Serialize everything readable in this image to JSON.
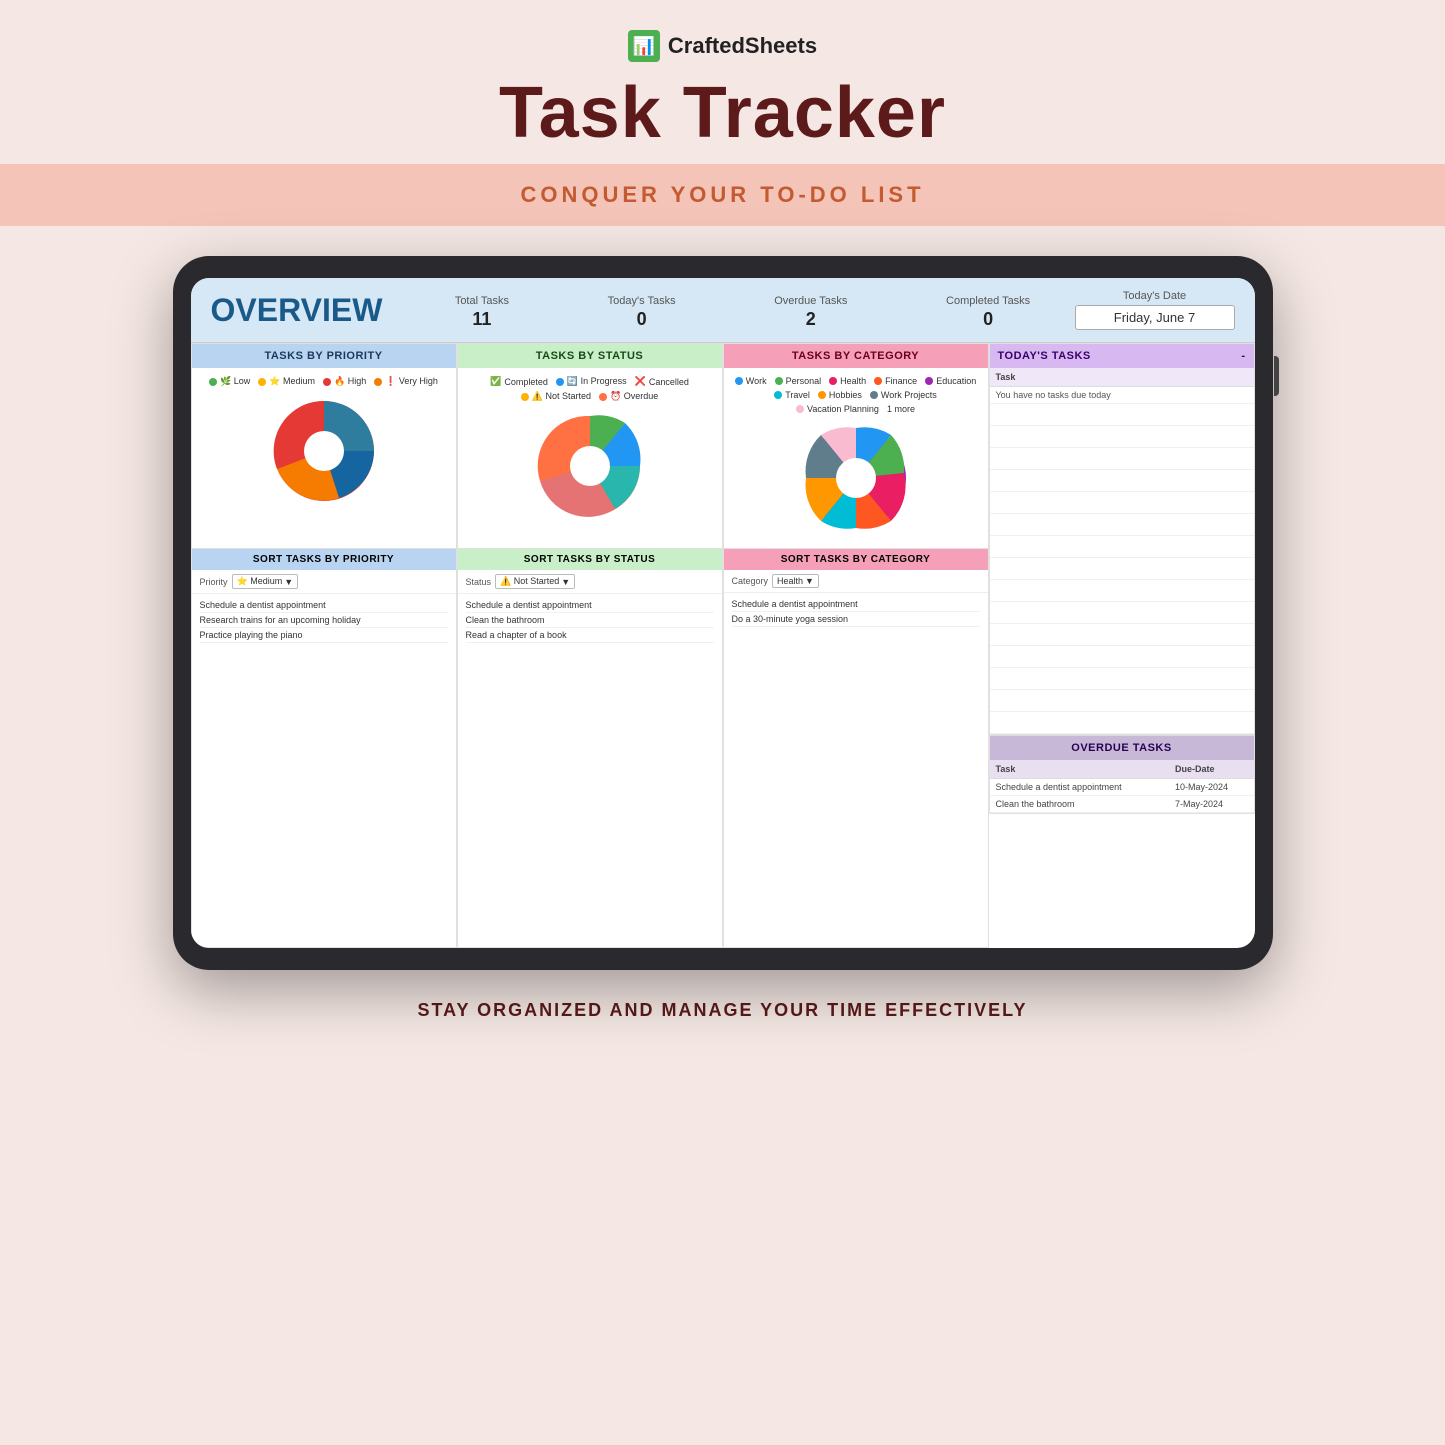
{
  "brand": {
    "name": "CraftedSheets",
    "icon": "📊"
  },
  "page_title": "Task Tracker",
  "subtitle": "CONQUER YOUR TO-DO LIST",
  "footer": "STAY ORGANIZED AND MANAGE YOUR TIME EFFECTIVELY",
  "overview": {
    "title": "OVERVIEW",
    "stats": {
      "total_tasks_label": "Total Tasks",
      "total_tasks_value": "11",
      "todays_tasks_label": "Today's Tasks",
      "todays_tasks_value": "0",
      "overdue_tasks_label": "Overdue Tasks",
      "overdue_tasks_value": "2",
      "completed_tasks_label": "Completed Tasks",
      "completed_tasks_value": "0"
    },
    "date": {
      "label": "Today's Date",
      "value": "Friday, June 7"
    }
  },
  "tasks_by_priority": {
    "header": "TASKS BY PRIORITY",
    "legend": [
      {
        "label": "Low",
        "color": "#4caf50",
        "icon": "🌿"
      },
      {
        "label": "Medium",
        "color": "#ffb300",
        "icon": "⭐"
      },
      {
        "label": "High",
        "color": "#e53935",
        "icon": "🔥"
      },
      {
        "label": "Very High",
        "color": "#f57c00",
        "icon": "❗"
      }
    ]
  },
  "tasks_by_status": {
    "header": "TASKS BY STATUS",
    "legend": [
      {
        "label": "Completed",
        "color": "#4caf50",
        "icon": "✅"
      },
      {
        "label": "In Progress",
        "color": "#2196f3",
        "icon": "🔄"
      },
      {
        "label": "Cancelled",
        "color": "#e53935",
        "icon": "❌"
      },
      {
        "label": "Not Started",
        "color": "#ffb300",
        "icon": "⚠️"
      },
      {
        "label": "Overdue",
        "color": "#ff7043",
        "icon": "⏰"
      }
    ]
  },
  "tasks_by_category": {
    "header": "TASKS BY CATEGORY",
    "legend": [
      {
        "label": "Work",
        "color": "#2196f3"
      },
      {
        "label": "Personal",
        "color": "#4caf50"
      },
      {
        "label": "Health",
        "color": "#e91e63"
      },
      {
        "label": "Finance",
        "color": "#ff5722"
      },
      {
        "label": "Education",
        "color": "#9c27b0"
      },
      {
        "label": "Travel",
        "color": "#00bcd4"
      },
      {
        "label": "Hobbies",
        "color": "#ff9800"
      },
      {
        "label": "Work Projects",
        "color": "#607d8b"
      },
      {
        "label": "Vacation Planning",
        "color": "#f8bbd0"
      },
      {
        "label": "1 more",
        "color": ""
      }
    ]
  },
  "todays_tasks": {
    "header": "TODAY'S TASKS",
    "table_header": "Task",
    "note": "You have no tasks due today",
    "items": []
  },
  "sort_priority": {
    "header": "SORT TASKS BY PRIORITY",
    "label": "Priority",
    "value": "⭐ Medium",
    "tasks": [
      "Schedule a dentist appointment",
      "Research trains for an upcoming holiday",
      "Practice playing the piano"
    ]
  },
  "sort_status": {
    "header": "SORT TASKS BY STATUS",
    "label": "Status",
    "value": "⚠️ Not Started",
    "tasks": [
      "Schedule a dentist appointment",
      "Clean the bathroom",
      "Read a chapter of a book"
    ]
  },
  "sort_category": {
    "header": "SORT TASKS BY CATEGORY",
    "label": "Category",
    "value": "Health",
    "tasks": [
      "Schedule a dentist appointment",
      "Do a 30-minute yoga session"
    ]
  },
  "overdue_tasks": {
    "header": "OVERDUE TASKS",
    "col_task": "Task",
    "col_due": "Due-Date",
    "items": [
      {
        "task": "Schedule a dentist appointment",
        "due": "10-May-2024"
      },
      {
        "task": "Clean the bathroom",
        "due": "7-May-2024"
      }
    ]
  }
}
